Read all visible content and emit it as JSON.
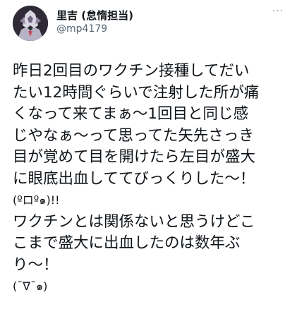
{
  "author": {
    "display_name": "里吉 (怠惰担当)",
    "handle": "@mp4179",
    "avatar_icon": "avatar-image"
  },
  "menu": {
    "more_icon": "more-options-icon",
    "glyph": "···"
  },
  "tweet": {
    "lines": [
      "昨日2回目のワクチン接種してだい",
      "たい12時間ぐらいで注射した所が痛",
      "くなって来てまぁ〜1回目と同じ感",
      "じやなぁ〜って思ってた矢先さっき",
      "目が覚めて目を開けたら左目が盛大",
      "に眼底出血しててびっくりした〜！",
      "(ºロº๑)!!",
      "ワクチンとは関係ないと思うけどこ",
      "こまで盛大に出血したのは数年ぶ",
      "り〜！",
      "(¯∇¯๑)"
    ]
  },
  "colors": {
    "text": "#0f1419",
    "secondary": "#536471",
    "background": "#ffffff"
  }
}
